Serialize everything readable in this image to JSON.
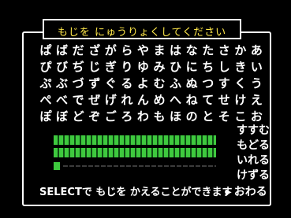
{
  "title": "もじを にゅうりょくしてください",
  "columns": [
    [
      "あ",
      "い",
      "う",
      "え",
      "お"
    ],
    [
      "か",
      "き",
      "く",
      "け",
      "こ"
    ],
    [
      "さ",
      "し",
      "す",
      "せ",
      "そ"
    ],
    [
      "た",
      "ち",
      "つ",
      "て",
      "と"
    ],
    [
      "な",
      "に",
      "ぬ",
      "ね",
      "の"
    ],
    [
      "は",
      "ひ",
      "ふ",
      "へ",
      "ほ"
    ],
    [
      "ま",
      "み",
      "む",
      "め",
      "も"
    ],
    [
      "や",
      "ゆ",
      "よ",
      "ん",
      "わ"
    ],
    [
      "ら",
      "り",
      "る",
      "れ",
      "ろ"
    ],
    [
      "が",
      "ぎ",
      "ぐ",
      "げ",
      "ご"
    ],
    [
      "ざ",
      "じ",
      "ず",
      "ぜ",
      "ぞ"
    ],
    [
      "だ",
      "ぢ",
      "づ",
      "で",
      "ど"
    ],
    [
      "ば",
      "び",
      "ぶ",
      "べ",
      "ぼ"
    ],
    [
      "ぱ",
      "ぴ",
      "ぷ",
      "ぺ",
      "ぽ"
    ]
  ],
  "menu": {
    "forward": "すすむ",
    "back": "もどる",
    "insert": "いれる",
    "delete": "けずる",
    "finish": "おわる"
  },
  "footer": "SELECTで もじを かえることができます",
  "pointer": "▶",
  "colors": {
    "title": "#ffe84a",
    "entry": "#3ec93e"
  }
}
